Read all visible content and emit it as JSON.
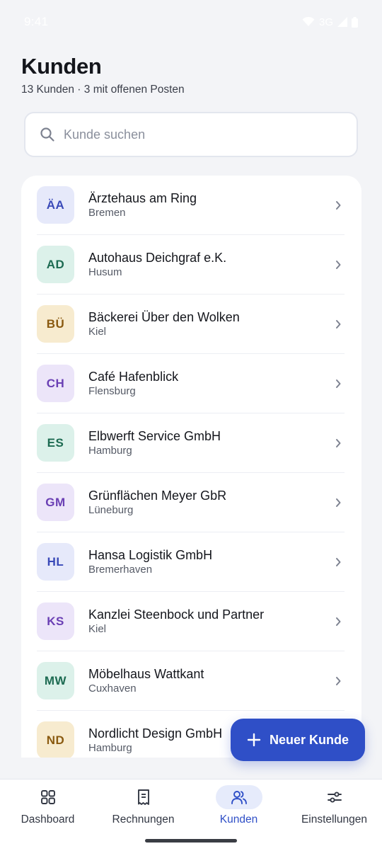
{
  "status_bar": {
    "time": "9:41",
    "network": "3G"
  },
  "header": {
    "title": "Kunden",
    "subtitle": "13 Kunden · 3 mit offenen Posten"
  },
  "search": {
    "placeholder": "Kunde suchen",
    "value": ""
  },
  "customers": [
    {
      "initials": "ÄA",
      "name": "Ärztehaus am Ring",
      "city": "Bremen",
      "bg": "#e6e9fa",
      "fg": "#3a4ab8"
    },
    {
      "initials": "AD",
      "name": "Autohaus Deichgraf e.K.",
      "city": "Husum",
      "bg": "#dcf1ea",
      "fg": "#1d6b52"
    },
    {
      "initials": "BÜ",
      "name": "Bäckerei Über den Wolken",
      "city": "Kiel",
      "bg": "#f7ebcf",
      "fg": "#8a5a10"
    },
    {
      "initials": "CH",
      "name": "Café Hafenblick",
      "city": "Flensburg",
      "bg": "#ece5f9",
      "fg": "#6a3fb4"
    },
    {
      "initials": "ES",
      "name": "Elbwerft Service GmbH",
      "city": "Hamburg",
      "bg": "#dcf1ea",
      "fg": "#1d6b52"
    },
    {
      "initials": "GM",
      "name": "Grünflächen Meyer GbR",
      "city": "Lüneburg",
      "bg": "#ece5f9",
      "fg": "#6a3fb4"
    },
    {
      "initials": "HL",
      "name": "Hansa Logistik GmbH",
      "city": "Bremerhaven",
      "bg": "#e6e9fa",
      "fg": "#3a4ab8"
    },
    {
      "initials": "KS",
      "name": "Kanzlei Steenbock und Partner",
      "city": "Kiel",
      "bg": "#ece5f9",
      "fg": "#6a3fb4"
    },
    {
      "initials": "MW",
      "name": "Möbelhaus Wattkant",
      "city": "Cuxhaven",
      "bg": "#dcf1ea",
      "fg": "#1d6b52"
    },
    {
      "initials": "ND",
      "name": "Nordlicht Design GmbH",
      "city": "Hamburg",
      "bg": "#f7ebcf",
      "fg": "#8a5a10"
    }
  ],
  "fab": {
    "label": "Neuer Kunde",
    "icon": "plus-icon"
  },
  "nav": [
    {
      "label": "Dashboard",
      "icon": "grid-icon",
      "active": false
    },
    {
      "label": "Rechnungen",
      "icon": "receipt-icon",
      "active": false
    },
    {
      "label": "Kunden",
      "icon": "users-icon",
      "active": true
    },
    {
      "label": "Einstellungen",
      "icon": "sliders-icon",
      "active": false
    }
  ],
  "colors": {
    "accent": "#2f4fc7",
    "accent_soft": "#e6ebfb",
    "background": "#f3f4f7"
  }
}
